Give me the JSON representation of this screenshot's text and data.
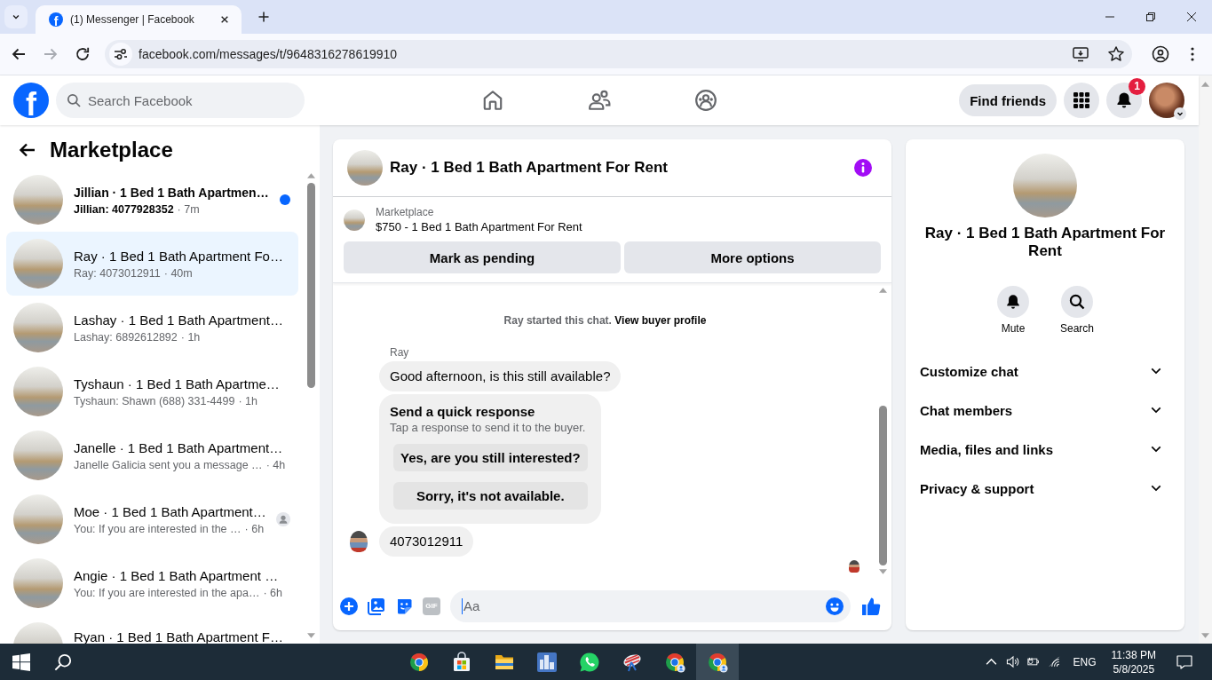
{
  "browser": {
    "tab_title": "(1) Messenger | Facebook",
    "favicon_letter": "f",
    "url": "facebook.com/messages/t/9648316278619910",
    "nav_buttons": [
      {
        "kind": "back",
        "disabled": false
      },
      {
        "kind": "forward",
        "disabled": true
      },
      {
        "kind": "reload",
        "disabled": false
      }
    ]
  },
  "header": {
    "logo_letter": "f",
    "search_placeholder": "Search Facebook",
    "nav": [
      {
        "kind": "home",
        "selected": false
      },
      {
        "kind": "friends",
        "selected": false
      },
      {
        "kind": "groups",
        "selected": false
      }
    ],
    "find_friends": "Find friends",
    "notification_badge": "1"
  },
  "sidebar": {
    "title": "Marketplace",
    "conversations": [
      {
        "title": "Jillian · 1 Bed 1 Bath Apartmen…",
        "preview": "Jillian: 4077928352",
        "time": "· 7m",
        "unread": true,
        "seen": false,
        "selected": false
      },
      {
        "title": "Ray · 1 Bed 1 Bath Apartment Fo…",
        "preview": "Ray: 4073012911",
        "time": "· 40m",
        "unread": false,
        "seen": false,
        "selected": true
      },
      {
        "title": "Lashay · 1 Bed 1 Bath Apartment…",
        "preview": "Lashay: 6892612892",
        "time": "· 1h",
        "unread": false,
        "seen": false,
        "selected": false
      },
      {
        "title": "Tyshaun · 1 Bed 1 Bath Apartme…",
        "preview": "Tyshaun: Shawn (688) 331-4499",
        "time": "· 1h",
        "unread": false,
        "seen": false,
        "selected": false
      },
      {
        "title": "Janelle · 1 Bed 1 Bath Apartment…",
        "preview": "Janelle Galicia sent you a message …",
        "time": "· 4h",
        "unread": false,
        "seen": false,
        "selected": false
      },
      {
        "title": "Moe · 1 Bed 1 Bath Apartment…",
        "preview": "You: If you are interested in the …",
        "time": "· 6h",
        "unread": false,
        "seen": true,
        "selected": false
      },
      {
        "title": "Angie · 1 Bed 1 Bath Apartment …",
        "preview": "You: If you are interested in the apa…",
        "time": "· 6h",
        "unread": false,
        "seen": false,
        "selected": false
      },
      {
        "title": "Ryan · 1 Bed 1 Bath Apartment F…",
        "selected": false
      }
    ]
  },
  "chat": {
    "title": "Ray · 1 Bed 1 Bath Apartment For Rent",
    "listing": {
      "source": "Marketplace",
      "title": "$750 - 1 Bed 1 Bath Apartment For Rent"
    },
    "actions": [
      "Mark as pending",
      "More options"
    ],
    "messages": [
      {
        "kind": "system",
        "text": "Ray started this chat.",
        "link": "View buyer profile"
      },
      {
        "kind": "text",
        "sender": "Ray",
        "text": "Good afternoon, is this still available?",
        "avatar": false
      },
      {
        "kind": "quick_responses",
        "title": "Send a quick response",
        "subtitle": "Tap a response to send it to the buyer.",
        "options": [
          "Yes, are you still interested?",
          "Sorry, it's not available."
        ]
      },
      {
        "kind": "text",
        "text": "4073012911",
        "avatar": true
      }
    ],
    "read_receipt": true,
    "composer": {
      "placeholder": "Aa",
      "gif_label": "GIF"
    }
  },
  "details": {
    "name": "Ray · 1 Bed 1 Bath Apartment For Rent",
    "actions": [
      {
        "kind": "mute",
        "label": "Mute"
      },
      {
        "kind": "search",
        "label": "Search"
      }
    ],
    "sections": [
      {
        "label": "Customize chat",
        "expanded": false
      },
      {
        "label": "Chat members",
        "expanded": false
      },
      {
        "label": "Media, files and links",
        "expanded": false
      },
      {
        "label": "Privacy & support",
        "expanded": false
      }
    ]
  },
  "taskbar": {
    "apps": [
      {
        "kind": "chrome",
        "active": false
      },
      {
        "kind": "store",
        "active": false
      },
      {
        "kind": "files",
        "active": false
      },
      {
        "kind": "tile",
        "active": false
      },
      {
        "kind": "whatsapp",
        "active": false
      },
      {
        "kind": "dish",
        "active": false
      },
      {
        "kind": "chrome_profile",
        "active": false
      },
      {
        "kind": "chrome_profile",
        "active": true
      }
    ],
    "tray": {
      "language": "ENG",
      "time": "11:38 PM",
      "date": "5/8/2025"
    }
  }
}
